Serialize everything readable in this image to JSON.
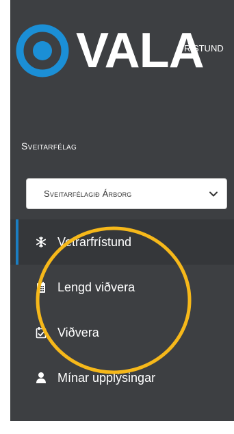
{
  "brand": {
    "name": "VALA",
    "subtitle": "FRÍSTUND",
    "accent_color": "#1b8fd6"
  },
  "municipality": {
    "label": "Sveitarfélag",
    "selected": "Sveitarfélagið Árborg"
  },
  "menu": [
    {
      "label": "Vetrarfrístund",
      "icon": "snowflake-icon",
      "active": true
    },
    {
      "label": "Lengd viðvera",
      "icon": "calendar-icon",
      "active": false
    },
    {
      "label": "Viðvera",
      "icon": "calendar-check-icon",
      "active": false
    },
    {
      "label": "Mínar upplýsingar",
      "icon": "user-icon",
      "active": false
    }
  ],
  "colors": {
    "sidebar_bg": "#3d3f42",
    "active_bg": "#35373a",
    "active_indicator": "#1b7ec2",
    "annotation": "#f6b81a"
  }
}
